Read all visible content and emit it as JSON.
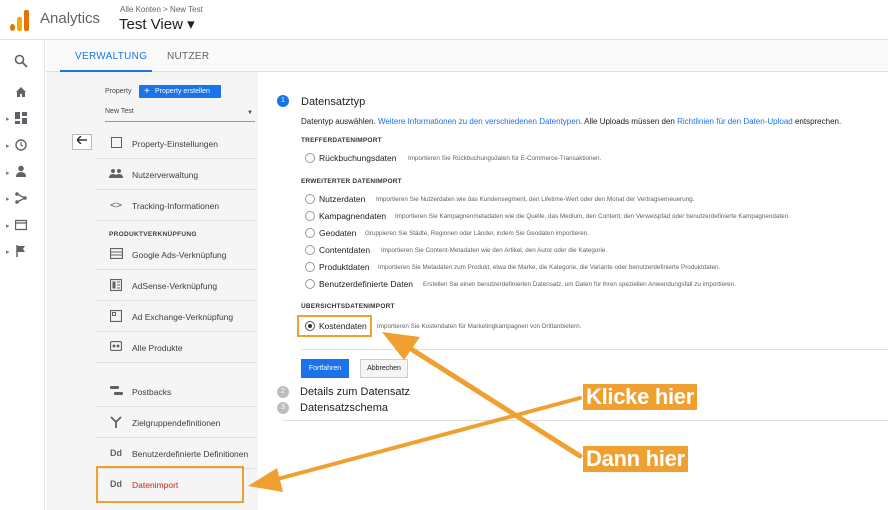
{
  "header": {
    "app_name": "Analytics",
    "breadcrumb": "Alle Konten > New Test",
    "view_title": "Test View ▾"
  },
  "tabs": [
    {
      "label": "VERWALTUNG",
      "active": true
    },
    {
      "label": "NUTZER",
      "active": false
    }
  ],
  "rail_icons": [
    "search-icon",
    "home-icon",
    "dashboard-icon",
    "clock-icon",
    "person-icon",
    "flow-icon",
    "display-icon",
    "flag-icon"
  ],
  "property": {
    "label": "Property",
    "create_button": "Property erstellen",
    "selected": "New Test"
  },
  "nav": {
    "items": [
      {
        "label": "Property-Einstellungen",
        "icon": "window-icon"
      },
      {
        "label": "Nutzerverwaltung",
        "icon": "people-icon"
      },
      {
        "label": "Tracking-Informationen",
        "icon": "code-icon"
      }
    ],
    "section_label": "PRODUKTVERKNÜPFUNG",
    "product_items": [
      {
        "label": "Google Ads-Verknüpfung",
        "icon": "ads-icon"
      },
      {
        "label": "AdSense-Verknüpfung",
        "icon": "adsense-icon"
      },
      {
        "label": "Ad Exchange-Verknüpfung",
        "icon": "adexchange-icon"
      },
      {
        "label": "Alle Produkte",
        "icon": "link-icon"
      }
    ],
    "other_items": [
      {
        "label": "Postbacks",
        "icon": "postback-icon"
      },
      {
        "label": "Zielgruppendefinitionen",
        "icon": "audience-icon"
      },
      {
        "label": "Benutzerdefinierte Definitionen",
        "icon": "dd-icon"
      },
      {
        "label": "Datenimport",
        "icon": "dd-icon",
        "active": true
      }
    ]
  },
  "content": {
    "step1": {
      "number": "1",
      "title": "Datensatztyp"
    },
    "intro_prefix": "Datentyp auswählen. ",
    "intro_link1": "Weitere Informationen zu den verschiedenen Datentypen",
    "intro_mid": ". Alle Uploads müssen den ",
    "intro_link2": "Richtlinien für den Daten-Upload",
    "intro_suffix": " entsprechen.",
    "sections": {
      "treffer": "TREFFERDATENIMPORT",
      "erweitert": "ERWEITERTER DATENIMPORT",
      "uebersicht": "ÜBERSICHTSDATENIMPORT"
    },
    "treffer_options": [
      {
        "label": "Rückbuchungsdaten",
        "desc": "Importieren Sie Rückbuchungsdaten für E-Commerce-Transaktionen."
      }
    ],
    "erweitert_options": [
      {
        "label": "Nutzerdaten",
        "desc": "Importieren Sie Nutzerdaten wie das Kundensegment, den Lifetime-Wert oder den Monat der Vertragserneuerung."
      },
      {
        "label": "Kampagnendaten",
        "desc": "Importieren Sie Kampagnenmetadaten wie die Quelle, das Medium, den Content, den Verweispfad oder benutzerdefinierte Kampagnendaten."
      },
      {
        "label": "Geodaten",
        "desc": "Gruppieren Sie Städte, Regionen oder Länder, indem Sie Geodaten importieren."
      },
      {
        "label": "Contentdaten",
        "desc": "Importieren Sie Content-Metadaten wie den Artikel, den Autor oder die Kategorie."
      },
      {
        "label": "Produktdaten",
        "desc": "Importieren Sie Metadaten zum Produkt, etwa die Marke, die Kategorie, die Variante oder benutzerdefinierte Produktdaten."
      },
      {
        "label": "Benutzerdefinierte Daten",
        "desc": "Erstellen Sie einen benutzerdefinierten Datensatz, um Daten für ihren speziellen Anwendungsfall zu importieren."
      }
    ],
    "uebersicht_options": [
      {
        "label": "Kostendaten",
        "desc": "Importieren Sie Kostendaten für Marketingkampagnen von Drittanbietern.",
        "selected": true
      }
    ],
    "continue_button": "Fortfahren",
    "cancel_button": "Abbrechen",
    "step2": {
      "number": "2",
      "title": "Details zum Datensatz"
    },
    "step3": {
      "number": "3",
      "title": "Datensatzschema"
    }
  },
  "annotations": {
    "click_here": "Klicke hier",
    "then_here": "Dann hier"
  },
  "colors": {
    "accent": "#1a73e8",
    "highlight": "#f0a030"
  }
}
